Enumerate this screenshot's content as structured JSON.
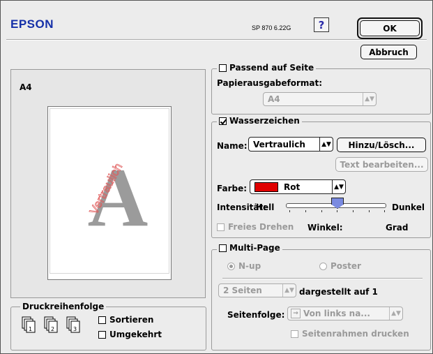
{
  "header": {
    "brand": "EPSON",
    "version": "SP 870 6.22G",
    "help_label": "?"
  },
  "buttons": {
    "ok": "OK",
    "cancel": "Abbruch",
    "add_remove": "Hinzu/Lösch...",
    "edit_text": "Text bearbeiten..."
  },
  "preview": {
    "paper_label": "A4",
    "watermark_letter": "A",
    "watermark_text": "Vertraulich"
  },
  "fit_to_page": {
    "label": "Passend auf Seite",
    "checked": false,
    "output_format_label": "Papierausgabeformat:",
    "output_format_value": "A4"
  },
  "watermark": {
    "label": "Wasserzeichen",
    "checked": true,
    "name_label": "Name:",
    "name_value": "Vertraulich",
    "color_label": "Farbe:",
    "color_value": "Rot",
    "color_swatch": "#e00000",
    "intensity_label": "Intensität:",
    "intensity_low": "Hell",
    "intensity_high": "Dunkel",
    "intensity_level": 0.5,
    "free_rotate_label": "Freies Drehen",
    "angle_label": "Winkel:",
    "angle_unit": "Grad"
  },
  "print_order": {
    "label": "Druckreihenfolge",
    "collate_label": "Sortieren",
    "reverse_label": "Umgekehrt",
    "page_numbers": [
      "1",
      "2",
      "3"
    ]
  },
  "multipage": {
    "label": "Multi-Page",
    "checked": false,
    "nup_label": "N-up",
    "poster_label": "Poster",
    "pages_value": "2 Seiten",
    "pages_suffix": "dargestellt auf 1",
    "order_label": "Seitenfolge:",
    "order_value": "Von links na...",
    "border_label": "Seitenrahmen drucken"
  }
}
